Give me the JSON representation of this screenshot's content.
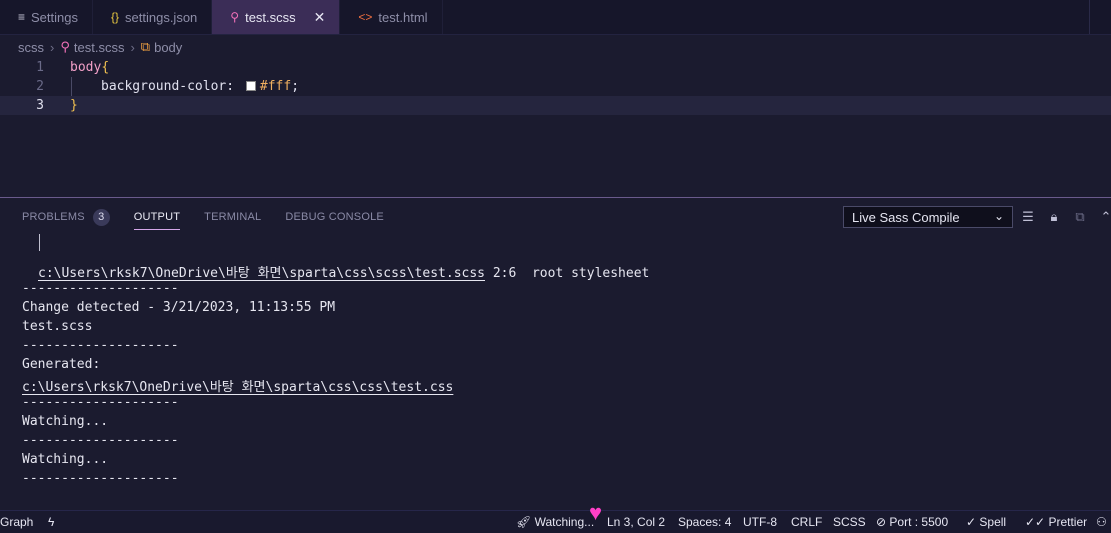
{
  "tabs": [
    {
      "icon": "≡",
      "label": "Settings"
    },
    {
      "icon": "{}",
      "label": "settings.json"
    },
    {
      "icon": "⚲",
      "label": "test.scss",
      "close": "✕"
    },
    {
      "icon": "<>",
      "label": "test.html"
    }
  ],
  "breadcrumb": {
    "folder": "scss",
    "file": "test.scss",
    "symbol": "body"
  },
  "editor": {
    "line_numbers": [
      "1",
      "2",
      "3"
    ],
    "line1_selector": "body",
    "line1_brace": "{",
    "line2_prop": "background-color:",
    "line2_value": "#fff",
    "line2_semicolon": ";",
    "line3_brace": "}"
  },
  "panel": {
    "tabs": [
      {
        "label": "PROBLEMS",
        "badge": "3"
      },
      {
        "label": "OUTPUT"
      },
      {
        "label": "TERMINAL"
      },
      {
        "label": "DEBUG CONSOLE"
      }
    ],
    "channel": "Live Sass Compile"
  },
  "output_lines": {
    "path1": "c:\\Users\\rksk7\\OneDrive\\바탕 화면\\sparta\\css\\scss\\test.scss",
    "path1_suffix": " 2:6  root stylesheet",
    "dash": "--------------------",
    "change": "Change detected - 3/21/2023, 11:13:55 PM",
    "file": "test.scss",
    "generated": "Generated:",
    "path2": "c:\\Users\\rksk7\\OneDrive\\바탕 화면\\sparta\\css\\css\\test.css",
    "watching": "Watching..."
  },
  "status": {
    "graph": "Graph",
    "watching": "Watching...",
    "position": "Ln 3, Col 2",
    "spaces": "Spaces: 4",
    "encoding": "UTF-8",
    "eol": "CRLF",
    "language": "SCSS",
    "port": "Port : 5500",
    "spell": "Spell",
    "prettier": "Prettier"
  },
  "colors": {
    "active_tab": "#3b2d57",
    "panel_accent": "#d4a6e8",
    "annotation_heart": "#ff40c8"
  }
}
